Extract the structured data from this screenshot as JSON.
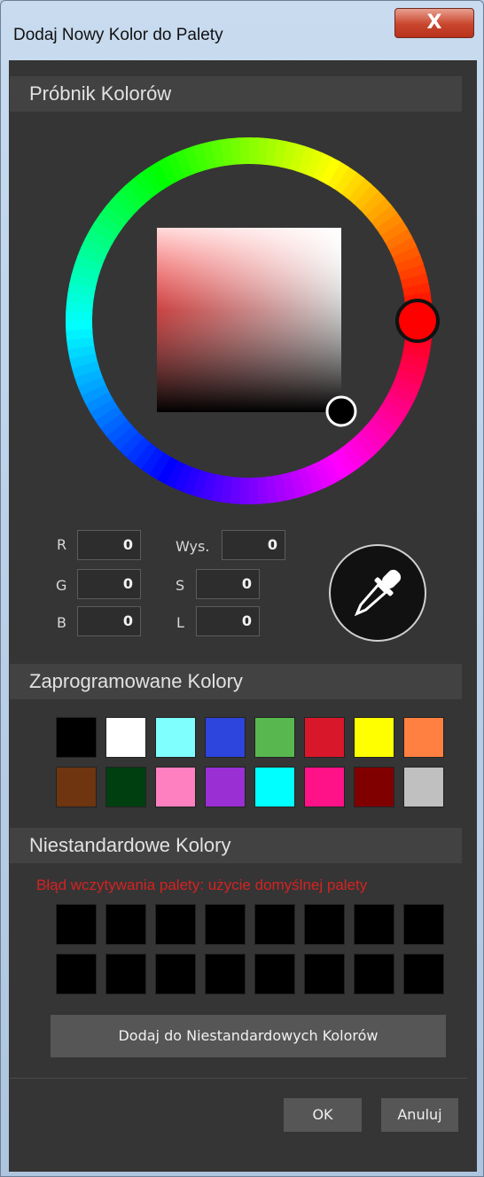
{
  "window": {
    "title": "Dodaj Nowy Kolor do Palety",
    "close_symbol": "X"
  },
  "picker": {
    "section_title": "Próbnik Kolorów",
    "hue_handle_color": "#ff0000",
    "fields": {
      "r_label": "R",
      "r_value": "0",
      "g_label": "G",
      "g_value": "0",
      "b_label": "B",
      "b_value": "0",
      "hue_label": "Wys.",
      "hue_value": "0",
      "s_label": "S",
      "s_value": "0",
      "l_label": "L",
      "l_value": "0"
    },
    "eyedropper_icon": "eyedropper-icon"
  },
  "preset": {
    "section_title": "Zaprogramowane Kolory",
    "colors": [
      "#000000",
      "#ffffff",
      "#80ffff",
      "#2d44dd",
      "#58b84f",
      "#d8182a",
      "#ffff00",
      "#ff8040",
      "#6e3510",
      "#004010",
      "#ff80c0",
      "#9a2fd4",
      "#00ffff",
      "#ff1188",
      "#800000",
      "#c0c0c0"
    ]
  },
  "custom": {
    "section_title": "Niestandardowe Kolory",
    "error": "Błąd wczytywania palety: użycie domyślnej palety",
    "colors": [
      "#000000",
      "#000000",
      "#000000",
      "#000000",
      "#000000",
      "#000000",
      "#000000",
      "#000000",
      "#000000",
      "#000000",
      "#000000",
      "#000000",
      "#000000",
      "#000000",
      "#000000",
      "#000000"
    ],
    "add_button": "Dodaj do Niestandardowych Kolorów"
  },
  "footer": {
    "ok": "OK",
    "cancel": "Anuluj"
  }
}
